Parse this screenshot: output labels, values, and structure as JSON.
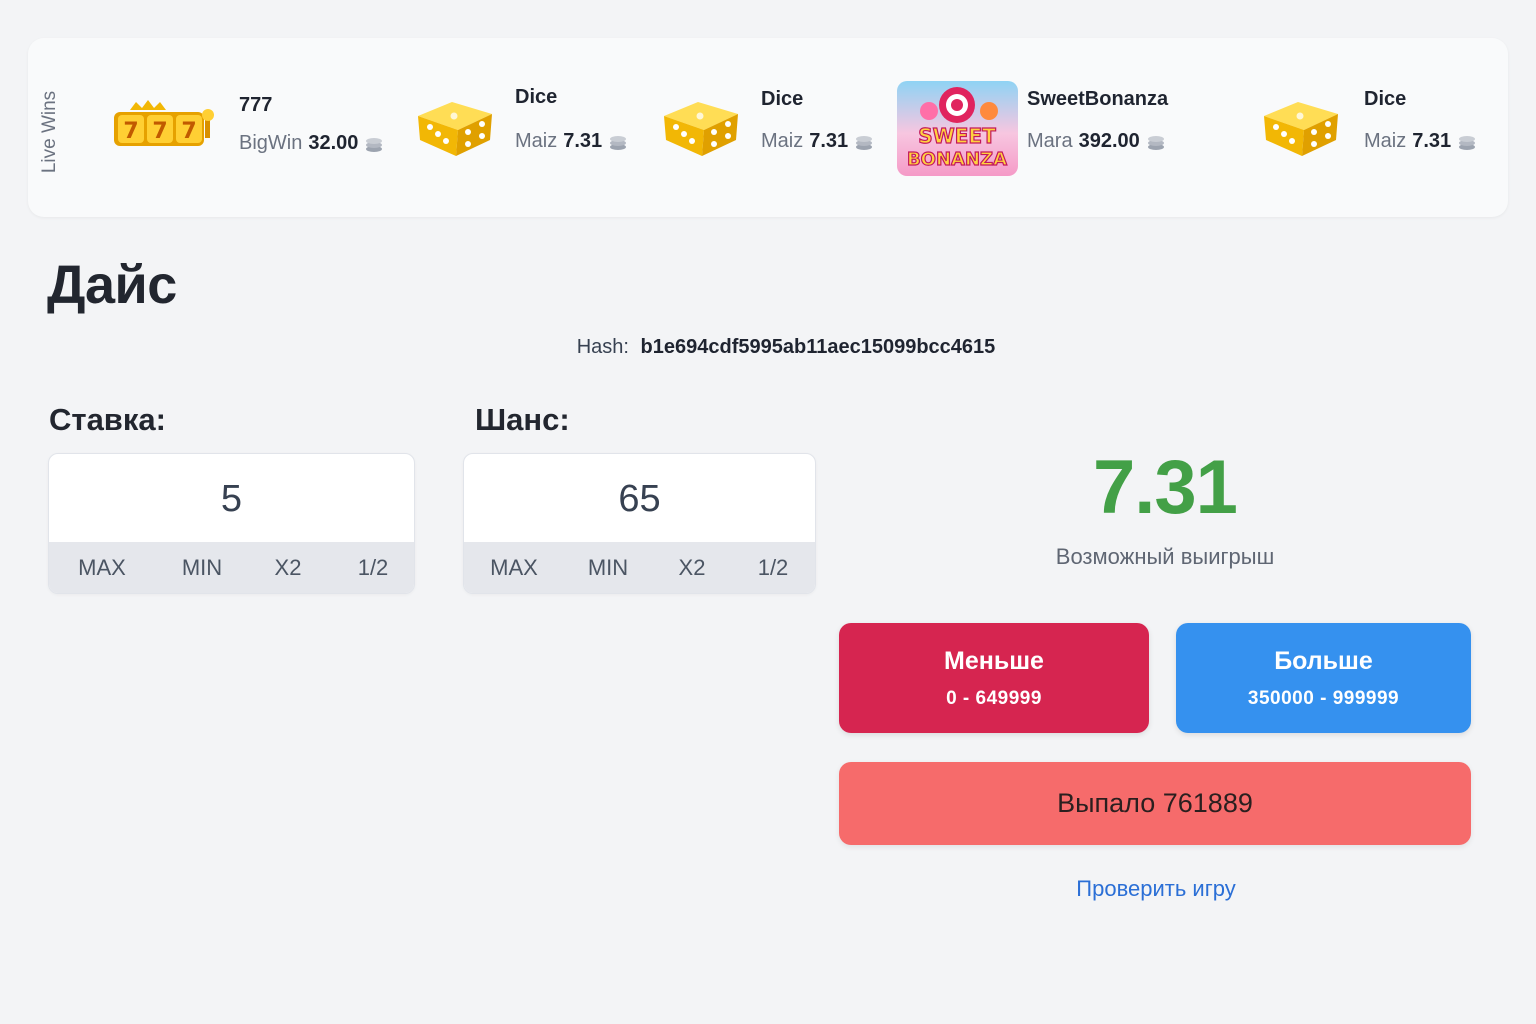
{
  "live_wins": {
    "label": "Live Wins",
    "items": [
      {
        "game": "777",
        "player": "BigWin",
        "amount": "32.00",
        "thumb": "slot-777-icon"
      },
      {
        "game": "Dice",
        "player": "Maiz",
        "amount": "7.31",
        "thumb": "dice-icon"
      },
      {
        "game": "Dice",
        "player": "Maiz",
        "amount": "7.31",
        "thumb": "dice-icon"
      },
      {
        "game": "SweetBonanza",
        "player": "Mara",
        "amount": "392.00",
        "thumb": "sweet-bonanza-icon"
      },
      {
        "game": "Dice",
        "player": "Maiz",
        "amount": "7.31",
        "thumb": "dice-icon"
      }
    ]
  },
  "page": {
    "title": "Дайс",
    "hash_label": "Hash:",
    "hash_value": "b1e694cdf5995ab11aec15099bcc4615"
  },
  "bet": {
    "label": "Ставка:",
    "value": "5",
    "actions": [
      "MAX",
      "MIN",
      "X2",
      "1/2"
    ]
  },
  "chance": {
    "label": "Шанс:",
    "value": "65",
    "actions": [
      "MAX",
      "MIN",
      "X2",
      "1/2"
    ]
  },
  "payout": {
    "value": "7.31",
    "label": "Возможный выигрыш"
  },
  "buttons": {
    "less_title": "Меньше",
    "less_range": "0 - 649999",
    "more_title": "Больше",
    "more_range": "350000 - 999999"
  },
  "result": {
    "text": "Выпало 761889"
  },
  "verify": {
    "text": "Проверить игру"
  },
  "colors": {
    "payout_green": "#43a047",
    "less_red": "#d62550",
    "more_blue": "#3591ef",
    "result_red": "#f66b6b",
    "link_blue": "#2b6fd6"
  }
}
